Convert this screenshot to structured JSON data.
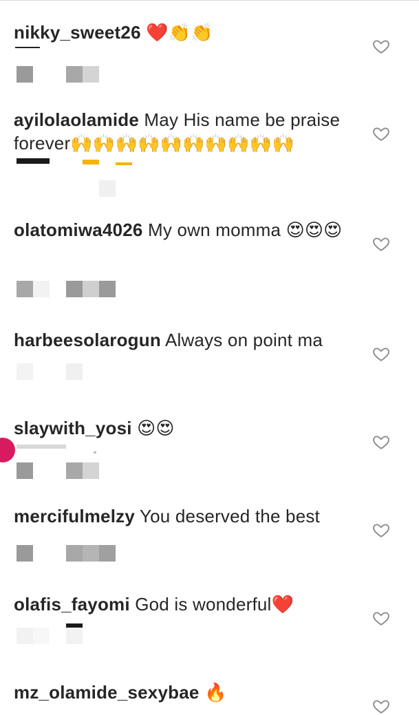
{
  "comments": [
    {
      "username": "nikky_sweet26",
      "text": "",
      "emojis": "❤️👏👏",
      "like_icon": "heart-outline-icon"
    },
    {
      "username": "ayilolaolamide",
      "text": "May His name be praise forever",
      "emojis": "🙌🙌🙌🙌🙌🙌🙌🙌🙌🙌",
      "like_icon": "heart-outline-icon"
    },
    {
      "username": "olatomiwa4026",
      "text": "My own momma",
      "emojis": "😍😍😍",
      "like_icon": "heart-outline-icon"
    },
    {
      "username": "harbeesolarogun",
      "text": "Always on point ma",
      "emojis": "",
      "like_icon": "heart-outline-icon"
    },
    {
      "username": "slaywith_yosi",
      "text": "",
      "emojis": "😍😍",
      "like_icon": "heart-outline-icon"
    },
    {
      "username": "mercifulmelzy",
      "text": "You deserved the best",
      "emojis": "",
      "like_icon": "heart-outline-icon"
    },
    {
      "username": "olafis_fayomi",
      "text": "God is wonderful",
      "emojis": "❤️",
      "like_icon": "heart-outline-icon"
    },
    {
      "username": "mz_olamide_sexybae",
      "text": "",
      "emojis": "🔥",
      "like_icon": "heart-outline-icon"
    }
  ],
  "colors": {
    "text": "#262626",
    "like_icon": "#8e8e8e",
    "divider": "#dbdbdb",
    "red_heart": "#e0192a",
    "story_ring": "#d81b60"
  }
}
